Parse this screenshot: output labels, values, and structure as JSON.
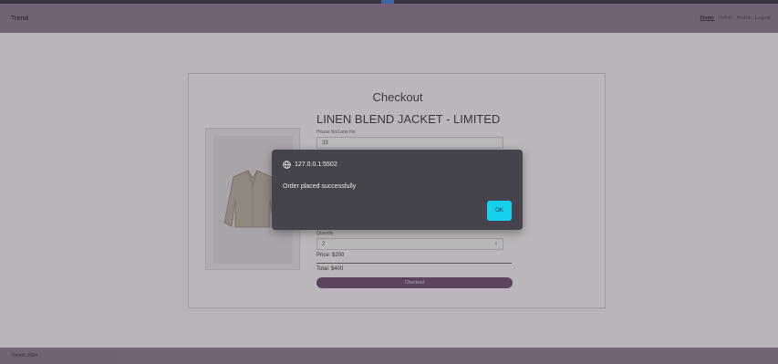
{
  "navbar": {
    "brand": "Trend",
    "links": [
      {
        "label": "Home"
      },
      {
        "label": "Orders"
      },
      {
        "label": "Profile"
      },
      {
        "label": "Logout"
      }
    ]
  },
  "checkout": {
    "title": "Checkout",
    "product_name": "LINEN BLEND JACKET - LIMITED",
    "house_label": "House No/Lane No",
    "house_value": "33",
    "quantity_label": "Quantity",
    "quantity_value": "2",
    "price": "Price: $200",
    "total": "Total: $400",
    "button_label": "Checkout"
  },
  "dialog": {
    "host": "127.0.0.1:5502",
    "message": "Order placed successfully",
    "ok_label": "OK",
    "accent": "#16d0f0"
  },
  "footer": {
    "text": "Trend© 2024"
  },
  "colors": {
    "navbar": "#8e7991",
    "button": "#6d4d6e"
  }
}
